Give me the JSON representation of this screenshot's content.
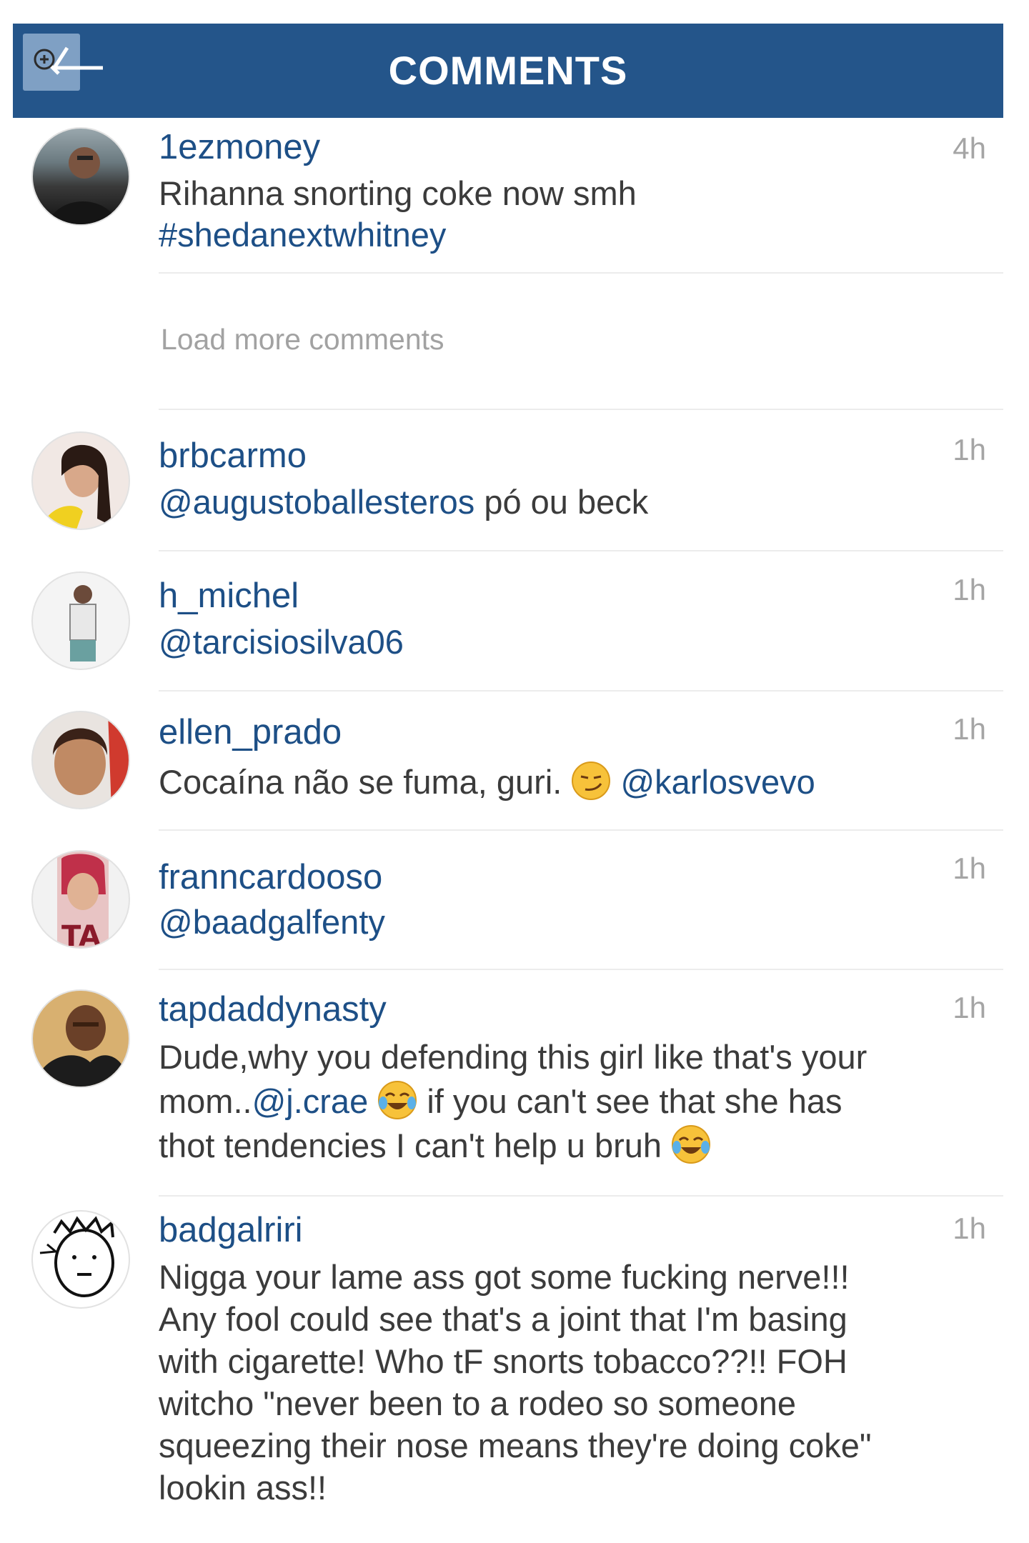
{
  "header": {
    "title": "COMMENTS",
    "back_icon": "zoom-back-icon"
  },
  "load_more": "Load more comments",
  "comments": [
    {
      "username": "1ezmoney",
      "time": "4h",
      "text": "Rihanna snorting coke now smh",
      "hashtag": "#shedanextwhitney"
    },
    {
      "username": "brbcarmo",
      "time": "1h",
      "mention": "@augustoballesteros",
      "text": " pó ou beck"
    },
    {
      "username": "h_michel",
      "time": "1h",
      "mention": "@tarcisiosilva06"
    },
    {
      "username": "ellen_prado",
      "time": "1h",
      "text": "Cocaína não se fuma, guri. ",
      "mention": "@karlosvevo",
      "emoji": "smirk-face-icon"
    },
    {
      "username": "franncardooso",
      "time": "1h",
      "mention": "@baadgalfenty"
    },
    {
      "username": "tapdaddynasty",
      "time": "1h",
      "line1": "Dude,why you defending this girl like that's your",
      "line2_pre": "mom..",
      "mention": "@j.crae",
      "line2_post": " if you can't see that she has",
      "line3": "thot tendencies I can't help u bruh",
      "emoji": "tears-of-joy-icon"
    },
    {
      "username": "badgalriri",
      "time": "1h",
      "lines": [
        "Nigga your lame ass got some fucking nerve!!!",
        "Any fool could see that's a joint that I'm basing",
        "with cigarette! Who tF snorts tobacco??!! FOH",
        "witcho \"never been to a rodeo so someone",
        "squeezing their nose means they're doing coke\"",
        "lookin ass!!"
      ]
    }
  ]
}
